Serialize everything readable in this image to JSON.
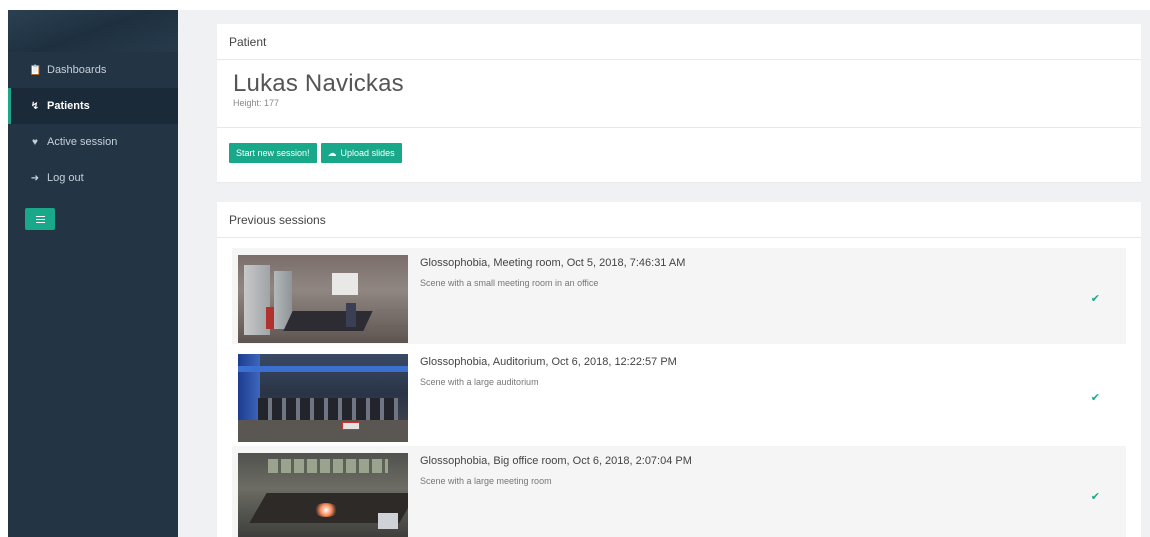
{
  "sidebar": {
    "items": [
      {
        "label": "Dashboards",
        "icon": "clipboard-icon"
      },
      {
        "label": "Patients",
        "icon": "stethoscope-icon"
      },
      {
        "label": "Active session",
        "icon": "heart-icon"
      },
      {
        "label": "Log out",
        "icon": "logout-icon"
      }
    ],
    "active_index": 1
  },
  "patient_panel": {
    "heading": "Patient",
    "name": "Lukas Navickas",
    "height_text": "Height: 177",
    "start_button": "Start new session!",
    "upload_button": "Upload slides"
  },
  "sessions_panel": {
    "heading": "Previous sessions",
    "sessions": [
      {
        "title": "Glossophobia, Meeting room, Oct 5, 2018, 7:46:31 AM",
        "description": "Scene with a small meeting room in an office",
        "completed": true
      },
      {
        "title": "Glossophobia, Auditorium, Oct 6, 2018, 12:22:57 PM",
        "description": "Scene with a large auditorium",
        "completed": true
      },
      {
        "title": "Glossophobia, Big office room, Oct 6, 2018, 2:07:04 PM",
        "description": "Scene with a large meeting room",
        "completed": true
      }
    ]
  },
  "colors": {
    "sidebar_bg": "#233445",
    "accent": "#19a98a",
    "content_bg": "#f0f1f3"
  }
}
